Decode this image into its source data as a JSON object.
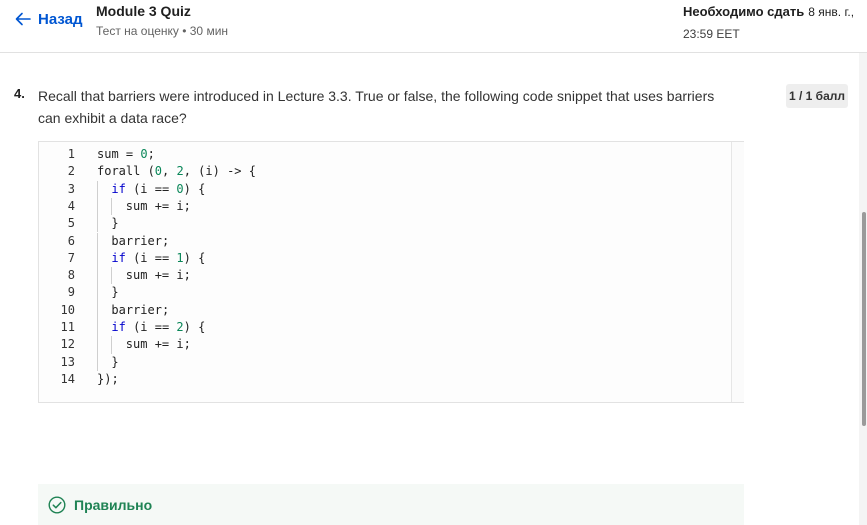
{
  "header": {
    "back_label": "Назад",
    "title": "Module 3 Quiz",
    "subtitle": "Тест на оценку • 30 мин",
    "due_label": "Необходимо сдать",
    "due_date": "8 янв. г.,",
    "due_time": "23:59 EET"
  },
  "question": {
    "number": "4.",
    "text": "Recall that barriers were introduced in Lecture 3.3.  True or false, the following code snippet that uses barriers can exhibit a data race?",
    "points": "1 / 1 балл"
  },
  "code": {
    "lines": [
      {
        "n": "1",
        "text": "sum = 0;"
      },
      {
        "n": "2",
        "text": "forall (0, 2, (i) -> {"
      },
      {
        "n": "3",
        "text": "if (i == 0) {"
      },
      {
        "n": "4",
        "text": "sum += i;"
      },
      {
        "n": "5",
        "text": "}"
      },
      {
        "n": "6",
        "text": "barrier;"
      },
      {
        "n": "7",
        "text": "if (i == 1) {"
      },
      {
        "n": "8",
        "text": "sum += i;"
      },
      {
        "n": "9",
        "text": "}"
      },
      {
        "n": "10",
        "text": "barrier;"
      },
      {
        "n": "11",
        "text": "if (i == 2) {"
      },
      {
        "n": "12",
        "text": "sum += i;"
      },
      {
        "n": "13",
        "text": "}"
      },
      {
        "n": "14",
        "text": "});"
      }
    ]
  },
  "result": {
    "label": "Правильно",
    "icon": "check-circle-icon"
  },
  "colors": {
    "accent": "#0056d2",
    "success": "#1f8354",
    "keyword": "#0000cc",
    "number": "#098658"
  }
}
